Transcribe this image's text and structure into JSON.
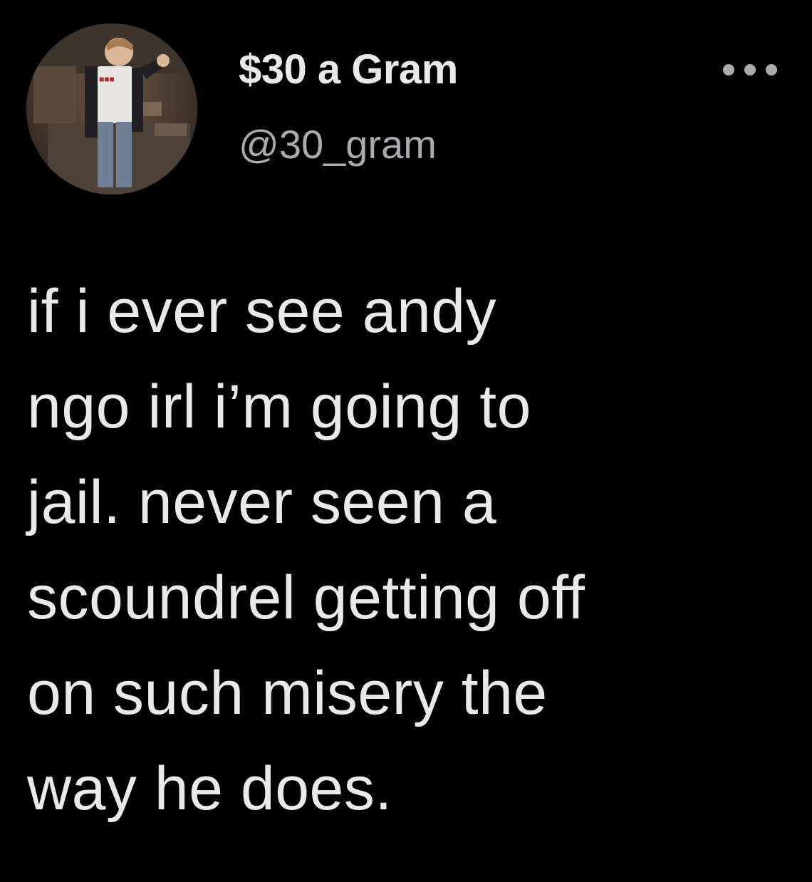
{
  "author": {
    "display_name": "$30 a Gram",
    "handle": "@30_gram",
    "avatar_icon": "profile-photo"
  },
  "more_icon": "more-options-icon",
  "tweet": {
    "lines": [
      "if i ever see andy",
      "ngo irl i’m going to",
      "jail. never seen a",
      "scoundrel getting off",
      "on such misery the",
      "way he does."
    ]
  },
  "colors": {
    "background": "#000000",
    "text_primary": "#e7e9ea",
    "text_secondary": "#a8acaf"
  }
}
